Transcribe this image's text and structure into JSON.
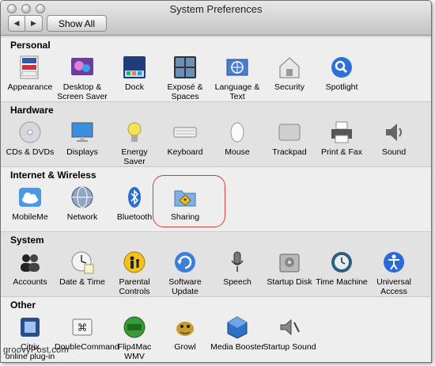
{
  "window": {
    "title": "System Preferences"
  },
  "toolbar": {
    "back": "◀",
    "forward": "▶",
    "show_all": "Show All"
  },
  "sections": {
    "personal": {
      "title": "Personal",
      "items": [
        {
          "label": "Appearance",
          "icon": "appearance-icon"
        },
        {
          "label": "Desktop &\nScreen Saver",
          "icon": "desktop-screensaver-icon"
        },
        {
          "label": "Dock",
          "icon": "dock-icon"
        },
        {
          "label": "Exposé &\nSpaces",
          "icon": "expose-spaces-icon"
        },
        {
          "label": "Language &\nText",
          "icon": "language-text-icon"
        },
        {
          "label": "Security",
          "icon": "security-icon"
        },
        {
          "label": "Spotlight",
          "icon": "spotlight-icon"
        }
      ]
    },
    "hardware": {
      "title": "Hardware",
      "items": [
        {
          "label": "CDs & DVDs",
          "icon": "cds-dvds-icon"
        },
        {
          "label": "Displays",
          "icon": "displays-icon"
        },
        {
          "label": "Energy\nSaver",
          "icon": "energy-saver-icon"
        },
        {
          "label": "Keyboard",
          "icon": "keyboard-icon"
        },
        {
          "label": "Mouse",
          "icon": "mouse-icon"
        },
        {
          "label": "Trackpad",
          "icon": "trackpad-icon"
        },
        {
          "label": "Print & Fax",
          "icon": "print-fax-icon"
        },
        {
          "label": "Sound",
          "icon": "sound-icon"
        }
      ]
    },
    "internet": {
      "title": "Internet & Wireless",
      "items": [
        {
          "label": "MobileMe",
          "icon": "mobileme-icon"
        },
        {
          "label": "Network",
          "icon": "network-icon"
        },
        {
          "label": "Bluetooth",
          "icon": "bluetooth-icon"
        },
        {
          "label": "Sharing",
          "icon": "sharing-icon"
        }
      ]
    },
    "system": {
      "title": "System",
      "items": [
        {
          "label": "Accounts",
          "icon": "accounts-icon"
        },
        {
          "label": "Date & Time",
          "icon": "date-time-icon"
        },
        {
          "label": "Parental\nControls",
          "icon": "parental-controls-icon"
        },
        {
          "label": "Software\nUpdate",
          "icon": "software-update-icon"
        },
        {
          "label": "Speech",
          "icon": "speech-icon"
        },
        {
          "label": "Startup Disk",
          "icon": "startup-disk-icon"
        },
        {
          "label": "Time Machine",
          "icon": "time-machine-icon"
        },
        {
          "label": "Universal\nAccess",
          "icon": "universal-access-icon"
        }
      ]
    },
    "other": {
      "title": "Other",
      "items": [
        {
          "label": "Citrix\nonline plug-in",
          "icon": "citrix-icon"
        },
        {
          "label": "DoubleCommand",
          "icon": "doublecommand-icon"
        },
        {
          "label": "Flip4Mac\nWMV",
          "icon": "flip4mac-icon"
        },
        {
          "label": "Growl",
          "icon": "growl-icon"
        },
        {
          "label": "Media Booster",
          "icon": "media-booster-icon"
        },
        {
          "label": "Startup Sound",
          "icon": "startup-sound-icon"
        }
      ]
    }
  },
  "watermark": "groovyPost.com"
}
